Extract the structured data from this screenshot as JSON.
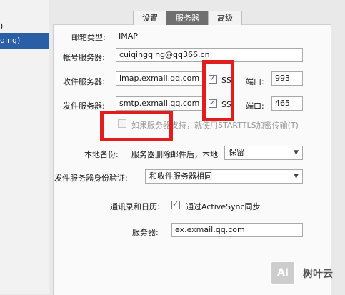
{
  "left_list": {
    "item_partial": ")",
    "selected_partial": "qing)"
  },
  "tabs": [
    {
      "label": "设置",
      "active": false
    },
    {
      "label": "服务器",
      "active": true
    },
    {
      "label": "高级",
      "active": false
    }
  ],
  "form": {
    "mailbox_type_label": "邮箱类型:",
    "mailbox_type_value": "IMAP",
    "account_server_label": "帐号服务器:",
    "account_server_value": "cuiqingqing@qq366.cn",
    "incoming_label": "收件服务器:",
    "incoming_value": "imap.exmail.qq.com",
    "incoming_ssl_label": "SS",
    "incoming_ssl_checked": true,
    "incoming_port_label": "端口:",
    "incoming_port_value": "993",
    "outgoing_label": "发件服务器:",
    "outgoing_value": "smtp.exmail.qq.com",
    "outgoing_ssl_label": "SS",
    "outgoing_ssl_checked": true,
    "outgoing_port_label": "端口:",
    "outgoing_port_value": "465",
    "starttls_text": "如果服务器支持，就使用STARTTLS加密传输(T)",
    "starttls_checked": false,
    "local_backup_label": "本地备份:",
    "local_backup_desc": "服务器删除邮件后，本地",
    "local_backup_value": "保留",
    "smtp_auth_label": "发件服务器身份验证:",
    "smtp_auth_value": "和收件服务器相同",
    "contacts_label": "通讯录和日历:",
    "activesync_label": "通过ActiveSync同步",
    "activesync_checked": true,
    "server_label": "服务器:",
    "server_value": "ex.exmail.qq.com"
  },
  "watermark": {
    "logo_text": "AI",
    "text": "树叶云"
  },
  "colors": {
    "annotation_red": "#e21d1d",
    "active_tab": "#6f6f6f",
    "selected_item": "#2a5fa5"
  }
}
